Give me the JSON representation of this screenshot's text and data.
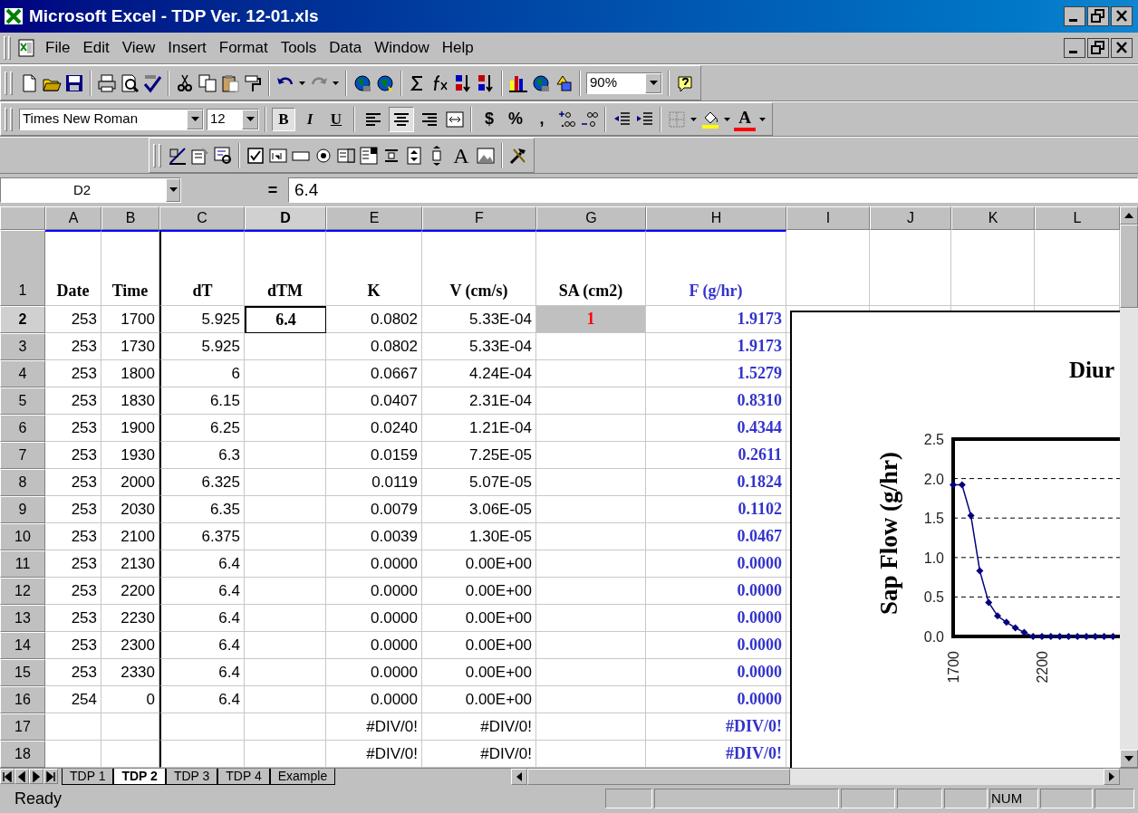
{
  "window": {
    "title": "Microsoft Excel - TDP Ver. 12-01.xls"
  },
  "menu": [
    "File",
    "Edit",
    "View",
    "Insert",
    "Format",
    "Tools",
    "Data",
    "Window",
    "Help"
  ],
  "zoom": "90%",
  "formatting": {
    "font": "Times New Roman",
    "size": "12",
    "styles": [
      {
        "label": "B",
        "pressed": true
      },
      {
        "label": "I",
        "pressed": false
      },
      {
        "label": "U",
        "pressed": false
      }
    ],
    "alignment": [
      {
        "pressed": false
      },
      {
        "pressed": true
      },
      {
        "pressed": false
      }
    ],
    "number_formats": [
      "$",
      "%",
      ","
    ],
    "font_color": "A"
  },
  "forms_toolbar": {
    "label_tool": "A"
  },
  "formula_bar": {
    "name_box": "D2",
    "equals": "=",
    "content": "6.4"
  },
  "columns": [
    {
      "letter": "A",
      "selected": false
    },
    {
      "letter": "B",
      "selected": false
    },
    {
      "letter": "C",
      "selected": false
    },
    {
      "letter": "D",
      "selected": true
    },
    {
      "letter": "E",
      "selected": false
    },
    {
      "letter": "F",
      "selected": false
    },
    {
      "letter": "G",
      "selected": false
    },
    {
      "letter": "H",
      "selected": false
    },
    {
      "letter": "I",
      "selected": false
    },
    {
      "letter": "J",
      "selected": false
    },
    {
      "letter": "K",
      "selected": false
    },
    {
      "letter": "L",
      "selected": false
    }
  ],
  "rows": [
    {
      "number": "1",
      "selected": false,
      "cells": {
        "A": "Date",
        "B": "Time",
        "C": "dT",
        "D": "dTM",
        "E": "K",
        "F": "V (cm/s)",
        "G": "SA (cm2)",
        "H": "F (g/hr)"
      }
    },
    {
      "number": "2",
      "selected": true,
      "cells": {
        "A": "253",
        "B": "1700",
        "C": "5.925",
        "D": "6.4",
        "E": "0.0802",
        "F": "5.33E-04",
        "G": "1",
        "H": "1.9173"
      }
    },
    {
      "number": "3",
      "selected": false,
      "cells": {
        "A": "253",
        "B": "1730",
        "C": "5.925",
        "E": "0.0802",
        "F": "5.33E-04",
        "H": "1.9173"
      }
    },
    {
      "number": "4",
      "selected": false,
      "cells": {
        "A": "253",
        "B": "1800",
        "C": "6",
        "E": "0.0667",
        "F": "4.24E-04",
        "H": "1.5279"
      }
    },
    {
      "number": "5",
      "selected": false,
      "cells": {
        "A": "253",
        "B": "1830",
        "C": "6.15",
        "E": "0.0407",
        "F": "2.31E-04",
        "H": "0.8310"
      }
    },
    {
      "number": "6",
      "selected": false,
      "cells": {
        "A": "253",
        "B": "1900",
        "C": "6.25",
        "E": "0.0240",
        "F": "1.21E-04",
        "H": "0.4344"
      }
    },
    {
      "number": "7",
      "selected": false,
      "cells": {
        "A": "253",
        "B": "1930",
        "C": "6.3",
        "E": "0.0159",
        "F": "7.25E-05",
        "H": "0.2611"
      }
    },
    {
      "number": "8",
      "selected": false,
      "cells": {
        "A": "253",
        "B": "2000",
        "C": "6.325",
        "E": "0.0119",
        "F": "5.07E-05",
        "H": "0.1824"
      }
    },
    {
      "number": "9",
      "selected": false,
      "cells": {
        "A": "253",
        "B": "2030",
        "C": "6.35",
        "E": "0.0079",
        "F": "3.06E-05",
        "H": "0.1102"
      }
    },
    {
      "number": "10",
      "selected": false,
      "cells": {
        "A": "253",
        "B": "2100",
        "C": "6.375",
        "E": "0.0039",
        "F": "1.30E-05",
        "H": "0.0467"
      }
    },
    {
      "number": "11",
      "selected": false,
      "cells": {
        "A": "253",
        "B": "2130",
        "C": "6.4",
        "E": "0.0000",
        "F": "0.00E+00",
        "H": "0.0000"
      }
    },
    {
      "number": "12",
      "selected": false,
      "cells": {
        "A": "253",
        "B": "2200",
        "C": "6.4",
        "E": "0.0000",
        "F": "0.00E+00",
        "H": "0.0000"
      }
    },
    {
      "number": "13",
      "selected": false,
      "cells": {
        "A": "253",
        "B": "2230",
        "C": "6.4",
        "E": "0.0000",
        "F": "0.00E+00",
        "H": "0.0000"
      }
    },
    {
      "number": "14",
      "selected": false,
      "cells": {
        "A": "253",
        "B": "2300",
        "C": "6.4",
        "E": "0.0000",
        "F": "0.00E+00",
        "H": "0.0000"
      }
    },
    {
      "number": "15",
      "selected": false,
      "cells": {
        "A": "253",
        "B": "2330",
        "C": "6.4",
        "E": "0.0000",
        "F": "0.00E+00",
        "H": "0.0000"
      }
    },
    {
      "number": "16",
      "selected": false,
      "cells": {
        "A": "254",
        "B": "0",
        "C": "6.4",
        "E": "0.0000",
        "F": "0.00E+00",
        "H": "0.0000"
      }
    },
    {
      "number": "17",
      "selected": false,
      "cells": {
        "E": "#DIV/0!",
        "F": "#DIV/0!",
        "H": "#DIV/0!"
      }
    },
    {
      "number": "18",
      "selected": false,
      "cells": {
        "E": "#DIV/0!",
        "F": "#DIV/0!",
        "H": "#DIV/0!"
      }
    }
  ],
  "chart": {
    "x_labels": [
      "1700",
      "2200"
    ],
    "chart_data": {
      "type": "line",
      "title": "Diur",
      "ylabel": "Sap Flow (g/hr)",
      "ylim": [
        0,
        2.5
      ],
      "grid": true,
      "yticks": [
        {
          "value": 0,
          "label": "0.0"
        },
        {
          "value": 0.5,
          "label": "0.5"
        },
        {
          "value": 1,
          "label": "1.0"
        },
        {
          "value": 1.5,
          "label": "1.5"
        },
        {
          "value": 2,
          "label": "2.0"
        },
        {
          "value": 2.5,
          "label": "2.5"
        }
      ],
      "series": [
        {
          "color": "#000080",
          "marker": "diamond",
          "values": [
            1.92,
            1.92,
            1.53,
            0.83,
            0.43,
            0.26,
            0.18,
            0.11,
            0.05,
            0,
            0,
            0,
            0,
            0,
            0,
            0,
            0,
            0,
            0
          ]
        }
      ]
    }
  },
  "sheet_tabs": [
    {
      "label": "TDP 1",
      "selected": false
    },
    {
      "label": "TDP 2",
      "selected": true
    },
    {
      "label": "TDP 3",
      "selected": false
    },
    {
      "label": "TDP 4",
      "selected": false
    },
    {
      "label": "Example",
      "selected": false
    }
  ],
  "status_bar": {
    "mode": "Ready",
    "indicators": [
      "NUM"
    ]
  }
}
